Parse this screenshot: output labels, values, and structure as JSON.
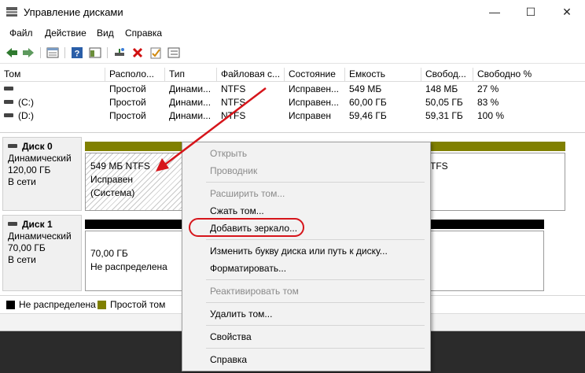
{
  "window": {
    "title": "Управление дисками",
    "controls": {
      "minimize": "—",
      "maximize": "☐",
      "close": "✕"
    }
  },
  "menu": [
    "Файл",
    "Действие",
    "Вид",
    "Справка"
  ],
  "toolbar_icons": [
    "back-arrow-icon",
    "forward-arrow-icon",
    "properties-icon",
    "help-icon",
    "console-tree-icon",
    "connect-drive-icon",
    "delete-icon",
    "check-icon",
    "list-icon"
  ],
  "volume_table": {
    "columns": [
      "Том",
      "Располо...",
      "Тип",
      "Файловая с...",
      "Состояние",
      "Емкость",
      "Свобод...",
      "Свободно %"
    ],
    "rows": [
      [
        "",
        "Простой",
        "Динами...",
        "NTFS",
        "Исправен...",
        "549 МБ",
        "148 МБ",
        "27 %"
      ],
      [
        "(C:)",
        "Простой",
        "Динами...",
        "NTFS",
        "Исправен...",
        "60,00 ГБ",
        "50,05 ГБ",
        "83 %"
      ],
      [
        "(D:)",
        "Простой",
        "Динами...",
        "NTFS",
        "Исправен",
        "59,46 ГБ",
        "59,31 ГБ",
        "100 %"
      ]
    ]
  },
  "disks": [
    {
      "name": "Диск 0",
      "type": "Динамический",
      "size": "120,00 ГБ",
      "status": "В сети",
      "partitions": [
        {
          "line1": "549 МБ NTFS",
          "line2": "Исправен (Система)"
        },
        {
          "line1": "",
          "line2": ""
        },
        {
          "line1": "TFS",
          "line2": ""
        }
      ]
    },
    {
      "name": "Диск 1",
      "type": "Динамический",
      "size": "70,00 ГБ",
      "status": "В сети",
      "partitions": [
        {
          "line1": "70,00 ГБ",
          "line2": "Не распределена"
        }
      ]
    }
  ],
  "legend": [
    {
      "label": "Не распределена",
      "color": "#000000"
    },
    {
      "label": "Простой том",
      "color": "#808000"
    }
  ],
  "context_menu": {
    "items": [
      {
        "label": "Открыть",
        "enabled": false
      },
      {
        "label": "Проводник",
        "enabled": false
      },
      {
        "label": "Расширить том...",
        "enabled": false
      },
      {
        "label": "Сжать том...",
        "enabled": true
      },
      {
        "label": "Добавить зеркало...",
        "enabled": true
      },
      {
        "label": "Изменить букву диска или путь к диску...",
        "enabled": true
      },
      {
        "label": "Форматировать...",
        "enabled": true
      },
      {
        "label": "Реактивировать том",
        "enabled": false
      },
      {
        "label": "Удалить том...",
        "enabled": true
      },
      {
        "label": "Свойства",
        "enabled": true
      },
      {
        "label": "Справка",
        "enabled": true
      }
    ]
  },
  "colors": {
    "simple_volume": "#808000",
    "unallocated": "#000000",
    "annotation": "#d6151b"
  }
}
